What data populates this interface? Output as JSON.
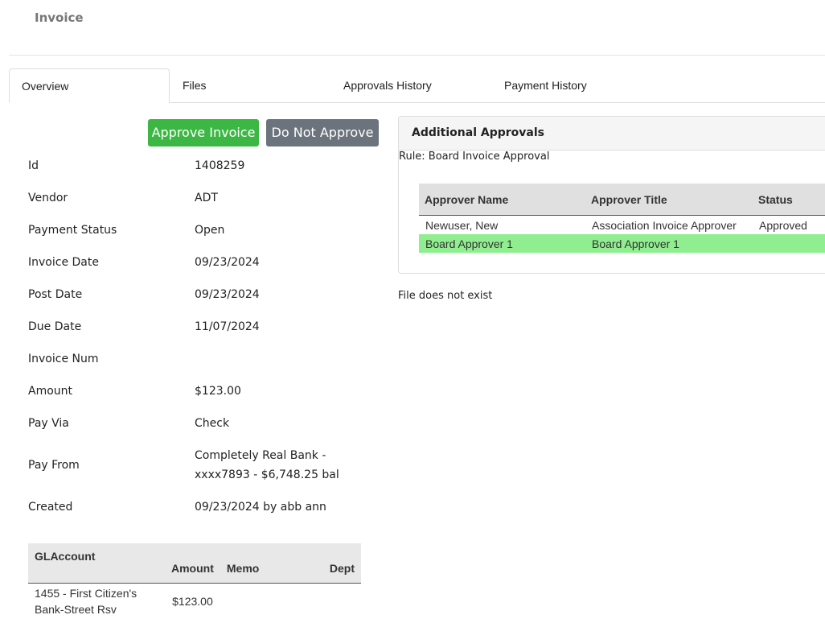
{
  "page": {
    "title": "Invoice"
  },
  "tabs": [
    {
      "label": "Overview",
      "active": true
    },
    {
      "label": "Files",
      "active": false
    },
    {
      "label": "Approvals History",
      "active": false
    },
    {
      "label": "Payment History",
      "active": false
    }
  ],
  "actions": {
    "approve_label": "Approve Invoice",
    "reject_label": "Do Not Approve"
  },
  "colors": {
    "approve": "#3cb744",
    "reject": "#6b747c",
    "highlight_row": "#90ee90"
  },
  "fields": [
    {
      "label": "Id",
      "value": "1408259"
    },
    {
      "label": "Vendor",
      "value": "ADT"
    },
    {
      "label": "Payment Status",
      "value": "Open"
    },
    {
      "label": "Invoice Date",
      "value": "09/23/2024"
    },
    {
      "label": "Post Date",
      "value": "09/23/2024"
    },
    {
      "label": "Due Date",
      "value": "11/07/2024"
    },
    {
      "label": "Invoice Num",
      "value": ""
    },
    {
      "label": "Amount",
      "value": "$123.00"
    },
    {
      "label": "Pay Via",
      "value": "Check"
    },
    {
      "label": "Pay From",
      "value_lines": [
        "Completely Real Bank -",
        "xxxx7893 - $6,748.25 bal"
      ]
    },
    {
      "label": "Created",
      "value": "09/23/2024 by abb ann"
    }
  ],
  "gl_table": {
    "headers": {
      "glaccount": "GLAccount",
      "amount": "Amount",
      "memo": "Memo",
      "dept": "Dept"
    },
    "rows": [
      {
        "glaccount_lines": [
          "1455 - First Citizen's",
          "Bank-Street Rsv"
        ],
        "amount": "$123.00",
        "memo": "",
        "dept": ""
      }
    ]
  },
  "additional_approvals": {
    "title": "Additional Approvals",
    "rule": "Rule: Board Invoice Approval",
    "headers": {
      "name": "Approver Name",
      "title": "Approver Title",
      "status": "Status"
    },
    "rows": [
      {
        "name": "Newuser, New",
        "title": "Association Invoice Approver",
        "status": "Approved"
      },
      {
        "name": "Board Approver 1",
        "title": "Board Approver 1",
        "status": ""
      }
    ]
  },
  "files": {
    "message": "File does not exist"
  }
}
